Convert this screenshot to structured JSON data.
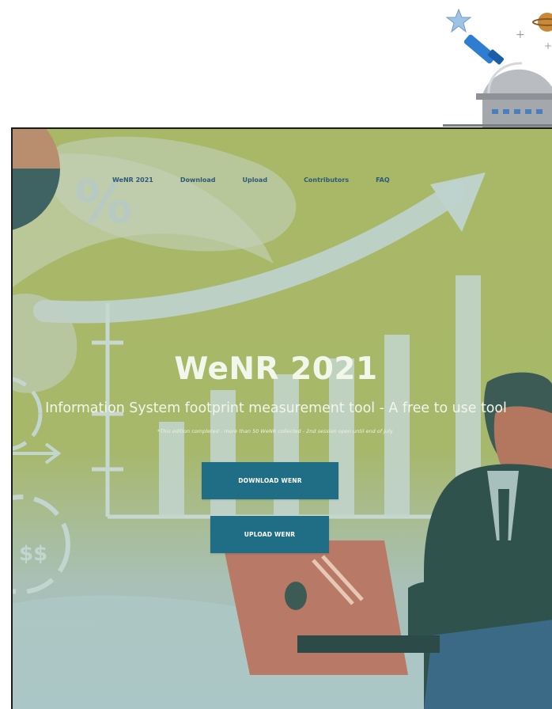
{
  "nav": {
    "items": [
      {
        "label": "WeNR 2021"
      },
      {
        "label": "Download"
      },
      {
        "label": "Upload"
      },
      {
        "label": "Contributors"
      },
      {
        "label": "FAQ"
      }
    ]
  },
  "hero": {
    "title": "WeNR 2021",
    "subtitle": "Information System footprint measurement tool - A free to use tool",
    "note": "*This edition completed - more than 50 WeNR collected - 2nd session open until end of July",
    "download_label": "DOWNLOAD WENR",
    "upload_label": "UPLOAD WENR"
  },
  "decor": {
    "percent_symbol": "%",
    "dollar_symbol": "$$"
  },
  "colors": {
    "hero_bg": "#a9b866",
    "cta": "#1f6e86",
    "nav_text": "#2d5a78",
    "title_text": "#f3f6ea"
  }
}
